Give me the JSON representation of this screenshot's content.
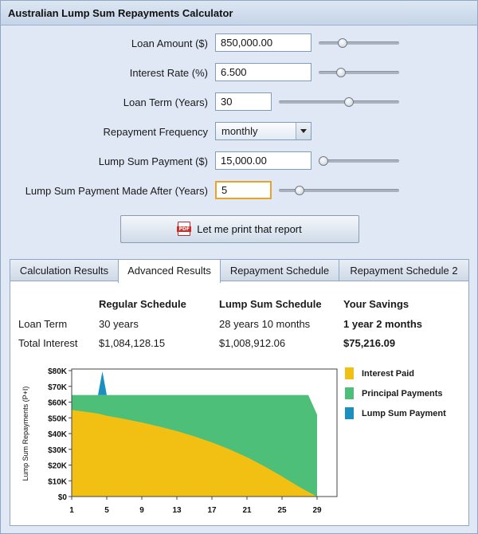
{
  "window": {
    "title": "Australian Lump Sum Repayments Calculator"
  },
  "form": {
    "loan_amount": {
      "label": "Loan Amount ($)",
      "value": "850,000.00",
      "slider": 0.3
    },
    "interest_rate": {
      "label": "Interest Rate (%)",
      "value": "6.500",
      "slider": 0.28
    },
    "loan_term": {
      "label": "Loan Term (Years)",
      "value": "30",
      "slider": 0.58
    },
    "frequency": {
      "label": "Repayment Frequency",
      "value": "monthly"
    },
    "lump_sum": {
      "label": "Lump Sum Payment ($)",
      "value": "15,000.00",
      "slider": 0.06
    },
    "lump_after": {
      "label": "Lump Sum Payment Made After (Years)",
      "value": "5",
      "slider": 0.17
    },
    "print_label": "Let me print that report"
  },
  "tabs": [
    {
      "label": "Calculation Results",
      "active": false
    },
    {
      "label": "Advanced Results",
      "active": true
    },
    {
      "label": "Repayment Schedule",
      "active": false
    },
    {
      "label": "Repayment Schedule 2",
      "active": false
    }
  ],
  "results": {
    "headers": [
      "Regular Schedule",
      "Lump Sum Schedule",
      "Your Savings"
    ],
    "rows": [
      {
        "label": "Loan Term",
        "regular": "30 years",
        "lump": "28 years 10 months",
        "savings": "1 year 2 months"
      },
      {
        "label": "Total Interest",
        "regular": "$1,084,128.15",
        "lump": "$1,008,912.06",
        "savings": "$75,216.09"
      }
    ]
  },
  "colors": {
    "interest": "#f2c012",
    "principal": "#4dbf78",
    "lump": "#1a8fc0"
  },
  "chart_data": {
    "type": "area",
    "ylabel": "Lump Sum Repayments (P+I)",
    "ylim": [
      0,
      80000
    ],
    "yticks": [
      "$0",
      "$10K",
      "$20K",
      "$30K",
      "$40K",
      "$50K",
      "$60K",
      "$70K",
      "$80K"
    ],
    "xticks": [
      "1",
      "5",
      "9",
      "13",
      "17",
      "21",
      "25",
      "29"
    ],
    "xlim": [
      1,
      30
    ],
    "series": [
      {
        "name": "Interest Paid",
        "x": [
          1,
          2,
          3,
          4,
          5,
          7,
          9,
          11,
          13,
          15,
          17,
          19,
          21,
          23,
          25,
          27,
          28,
          29
        ],
        "values": [
          55000,
          54300,
          53500,
          52700,
          51300,
          49300,
          47000,
          44400,
          41600,
          38200,
          34400,
          30000,
          25000,
          19200,
          12800,
          6000,
          3000,
          0
        ]
      },
      {
        "name": "Principal Payments",
        "x": [
          1,
          28,
          29
        ],
        "values": [
          64500,
          64500,
          52000
        ]
      },
      {
        "name": "Lump Sum Payment",
        "x": [
          4,
          4.5,
          5
        ],
        "values": [
          64500,
          79500,
          64500
        ]
      }
    ],
    "legend": [
      "Interest Paid",
      "Principal Payments",
      "Lump Sum Payment"
    ],
    "grid": false,
    "legend_position": "right"
  }
}
